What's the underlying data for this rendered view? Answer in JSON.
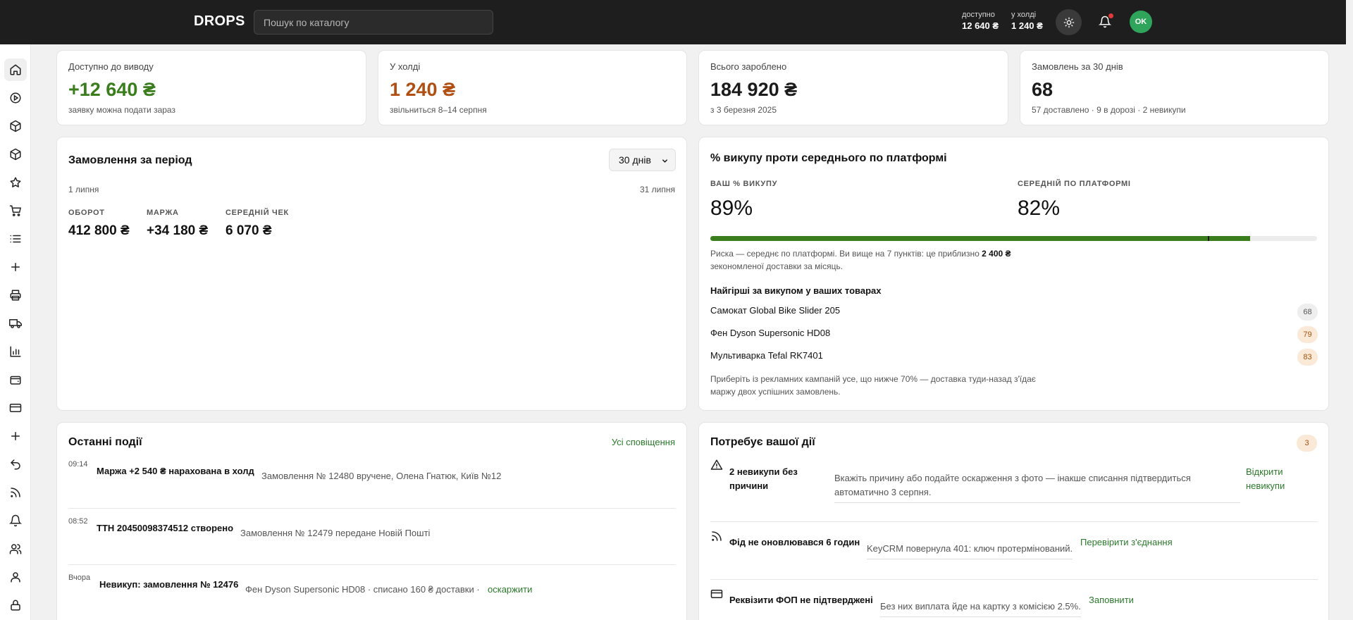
{
  "header": {
    "logo": "DROPS",
    "search_placeholder": "Пошук по каталогу",
    "available_label": "доступно",
    "available_value": "12 640 ₴",
    "hold_label": "у холді",
    "hold_value": "1 240 ₴",
    "avatar_initials": "OK"
  },
  "sidebar": {
    "icons": [
      "home-icon",
      "play-circle-icon",
      "box-icon",
      "box-icon",
      "star-icon",
      "cart-icon",
      "list-icon",
      "plus-icon",
      "printer-icon",
      "truck-icon",
      "chart-icon",
      "wallet-icon",
      "card-icon",
      "plus-icon",
      "return-icon",
      "rss-icon",
      "bell-icon",
      "users-icon",
      "user-icon",
      "lock-icon"
    ]
  },
  "kpis": [
    {
      "label": "Доступно до виводу",
      "value": "+12 640 ₴",
      "sub": "заявку можна подати зараз"
    },
    {
      "label": "У холді",
      "value": "1 240 ₴",
      "sub": "звільниться 8–14 серпня"
    },
    {
      "label": "Всього зароблено",
      "value": "184 920 ₴",
      "sub": "з 3 березня 2025"
    },
    {
      "label": "Замовлень за 30 днів",
      "value": "68",
      "sub": "57 доставлено · 9 в дорозі · 2 невикупи"
    }
  ],
  "orders_period": {
    "title": "Замовлення за період",
    "period": "30 днів",
    "date_start": "1 липня",
    "date_end": "31 липня",
    "turnover_label": "ОБОРОТ",
    "turnover_value": "412 800 ₴",
    "margin_label": "МАРЖА",
    "margin_value": "+34 180 ₴",
    "avg_label": "СЕРЕДНІЙ ЧЕК",
    "avg_value": "6 070 ₴"
  },
  "buyout": {
    "title": "% викупу проти середнього по платформі",
    "your_label": "ВАШ % ВИКУПУ",
    "your_value": "89%",
    "platform_label": "СЕРЕДНІЙ ПО ПЛАТФОРМІ",
    "platform_value": "82%",
    "your_fraction": 0.89,
    "platform_fraction": 0.82,
    "note_line1": "Риска — середнє по платформі. Ви вище на 7 пунктів: це приблизно",
    "note_bold": "2 400 ₴",
    "note_line2": "зекономленої доставки за місяць.",
    "worst_title": "Найгірші за викупом у ваших товарах",
    "worst": [
      {
        "name": "Самокат Global Bike Slider 205",
        "value": "68"
      },
      {
        "name": "Фен Dyson Supersonic HD08",
        "value": "79"
      },
      {
        "name": "Мультиварка Tefal RK7401",
        "value": "83"
      }
    ],
    "tip_line1": "Приберіть із рекламних кампаній усе, що нижче 70% — доставка туди-назад з'їдає",
    "tip_line2": "маржу двох успішних замовлень."
  },
  "events": {
    "title": "Останні події",
    "all_link": "Усі сповіщення",
    "items": [
      {
        "time": "09:14",
        "title": "Маржа +2 540 ₴ нарахована в холд",
        "desc": "Замовлення № 12480 вручене, Олена Гнатюк, Київ №12"
      },
      {
        "time": "08:52",
        "title": "ТТН 20450098374512 створено",
        "desc": "Замовлення № 12479 передане Новій Пошті"
      },
      {
        "time": "Вчора",
        "title": "Невикуп: замовлення № 12476",
        "desc": "Фен Dyson Supersonic HD08 · списано 160 ₴ доставки ·",
        "action": "оскаржити"
      }
    ]
  },
  "actions": {
    "title": "Потребує вашої дії",
    "count": "3",
    "items": [
      {
        "title_line1": "2 невикупи без",
        "title_line2": "причини",
        "desc_line1": "Вкажіть причину або подайте оскарження з фото — інакше списання підтвердиться",
        "desc_line2": "автоматично 3 серпня.",
        "action_line1": "Відкрити",
        "action_line2": "невикупи"
      },
      {
        "title": "Фід не оновлювався 6 годин",
        "desc": "KeyCRM повернула 401: ключ протермінований.",
        "action": "Перевірити з'єднання"
      },
      {
        "title": "Реквізити ФОП не підтверджені",
        "desc": "Без них виплата йде на картку з комісією 2.5%.",
        "action": "Заповнити"
      }
    ]
  }
}
